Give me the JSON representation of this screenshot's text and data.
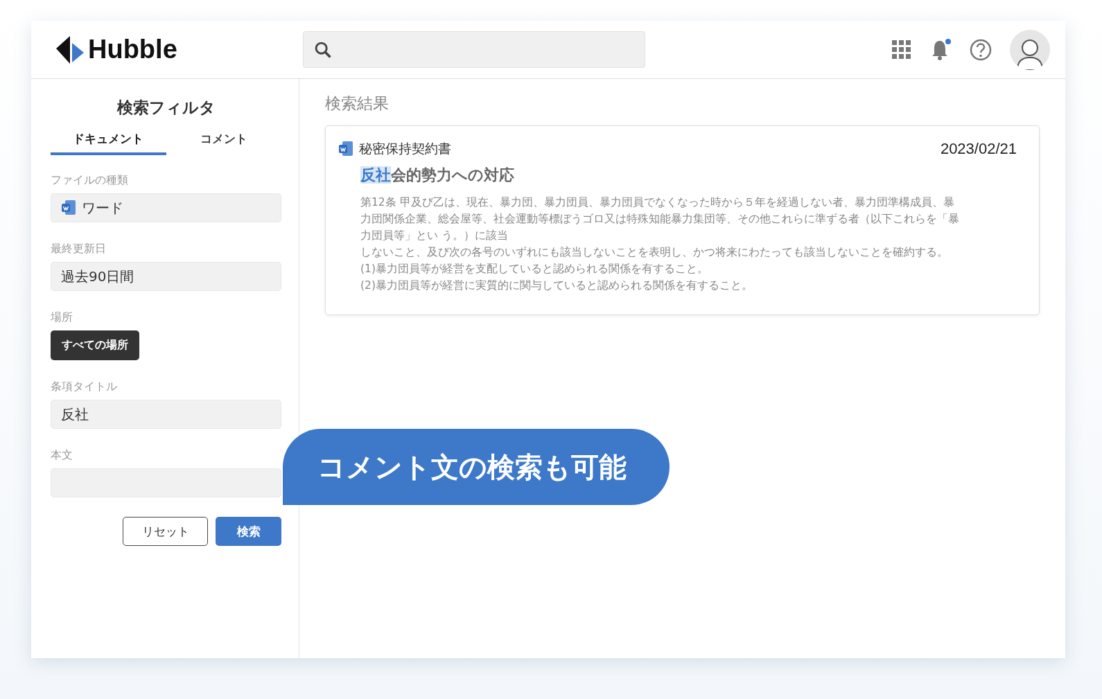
{
  "header": {
    "logo": "Hubble",
    "notifications_unread": true
  },
  "sidebar": {
    "title": "検索フィルタ",
    "tabs": [
      {
        "label": "ドキュメント",
        "selected": true
      },
      {
        "label": "コメント",
        "selected": false
      }
    ],
    "fields": [
      {
        "kind": "file",
        "label": "ファイルの種類",
        "value": "ワード"
      },
      {
        "kind": "text",
        "label": "最終更新日",
        "value": "過去90日間"
      },
      {
        "kind": "chip",
        "label": "場所",
        "value": "すべての場所"
      },
      {
        "kind": "text",
        "label": "条項タイトル",
        "value": "反社"
      },
      {
        "kind": "text",
        "label": "本文"
      }
    ],
    "buttons": [
      {
        "kind": "secondary",
        "label": "リセット"
      },
      {
        "kind": "primary",
        "label": "検索"
      }
    ]
  },
  "results": {
    "title": "検索結果",
    "items": [
      {
        "document": "秘密保持契約書",
        "date": "2023/02/21",
        "heading_match": "反社",
        "heading_rest": "会的勢力への対応",
        "paragraphs": [
          "第12条 甲及び乙は、現在、暴力団、暴力団員、暴力団員でなくなった時から５年を経過しない者、暴力団準構成員、暴",
          "力団関係企業、総会屋等、社会運動等標ぼうゴロ又は特殊知能暴力集団等、その他これらに準ずる者（以下これらを「暴",
          "力団員等」とい う。）に該当",
          "しないこと、及び次の各号のいずれにも該当しないことを表明し、かつ将来にわたっても該当しないことを確約する。",
          "(1)暴力団員等が経営を支配していると認められる関係を有すること。",
          "(2)暴力団員等が経営に実質的に関与していると認められる関係を有すること。"
        ]
      }
    ]
  },
  "callout": "コメント文の検索も可能"
}
